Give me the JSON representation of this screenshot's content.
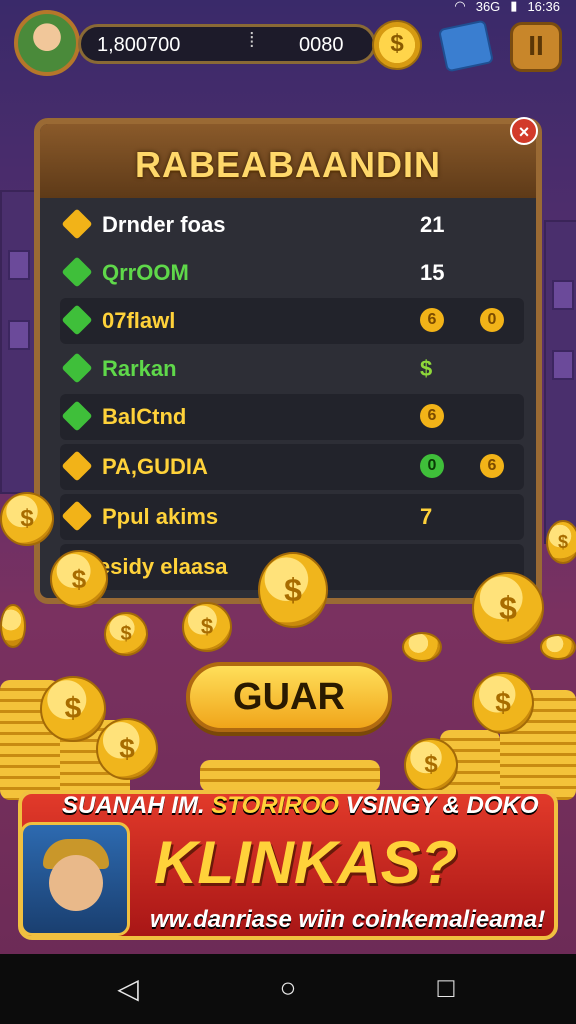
{
  "status_bar": {
    "time": "16:36",
    "signal_label": "36G"
  },
  "hud": {
    "score": "1,800700",
    "coins": "0080",
    "coin_symbol": "$",
    "pause_symbol": "II"
  },
  "panel": {
    "title": "RABEABAANDIN",
    "close_symbol": "×",
    "rows": [
      {
        "label": "Drnder foas",
        "value": "21",
        "icon_color": "#f2b318",
        "label_color": "#ffffff"
      },
      {
        "label": "QrrOOM",
        "value": "15",
        "icon_color": "#3fbf3a",
        "label_color": "#5fd84a"
      },
      {
        "label": "07flawl",
        "coin1": "6",
        "coin2": "0",
        "icon_color": "#3fbf3a",
        "label_color": "#ffd23a"
      },
      {
        "label": "Rarkan",
        "value": "$",
        "icon_color": "#3fbf3a",
        "label_color": "#5fd84a"
      },
      {
        "label": "BalCtnd",
        "coin1": "6",
        "icon_color": "#3fbf3a",
        "label_color": "#ffd23a"
      },
      {
        "label": "PA,GUDIA",
        "coin1": "0",
        "coin2": "6",
        "icon_color": "#f2b318",
        "label_color": "#ffd23a"
      },
      {
        "label": "Ppul akims",
        "value": "7",
        "icon_color": "#f2b318",
        "label_color": "#ffd23a"
      },
      {
        "label": "Cesidy elaasa",
        "icon_color": "#f2b318",
        "label_color": "#ffd23a"
      }
    ]
  },
  "primary_button": {
    "label": "GUAR"
  },
  "banner": {
    "top_line_a": "SUANAH IM.",
    "top_line_b": "STORIROO",
    "top_line_c": "VSINGY & DOKO",
    "headline": "KLINKAS?",
    "url": "ww.danriase wiin coinkemalieama!"
  },
  "nav": {
    "back": "◁",
    "home": "○",
    "recents": "□"
  }
}
